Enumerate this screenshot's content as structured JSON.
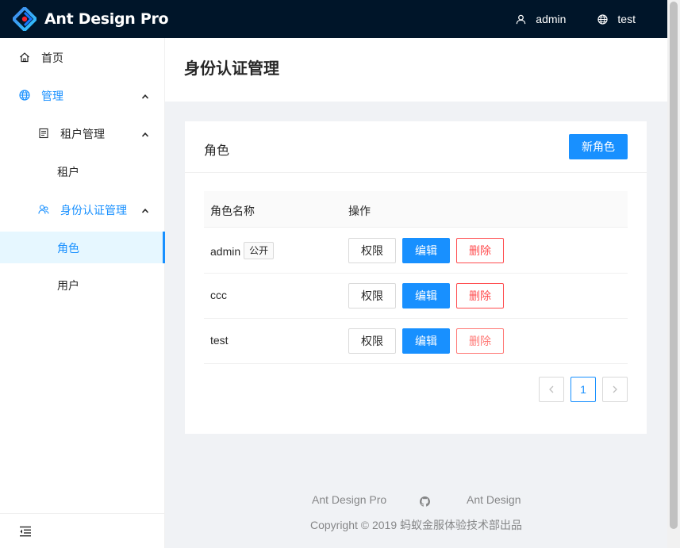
{
  "app": {
    "title": "Ant Design Pro"
  },
  "header": {
    "user": "admin",
    "tenant": "test"
  },
  "sidebar": {
    "items": [
      {
        "label": "首页"
      },
      {
        "label": "管理"
      },
      {
        "label": "租户管理"
      },
      {
        "label": "租户"
      },
      {
        "label": "身份认证管理"
      },
      {
        "label": "角色"
      },
      {
        "label": "用户"
      }
    ]
  },
  "page": {
    "title": "身份认证管理"
  },
  "card": {
    "title": "角色",
    "new_button": "新角色"
  },
  "table": {
    "columns": [
      "角色名称",
      "操作"
    ],
    "rows": [
      {
        "name": "admin",
        "tag": "公开",
        "actions": [
          "权限",
          "编辑",
          "删除"
        ]
      },
      {
        "name": "ccc",
        "tag": "",
        "actions": [
          "权限",
          "编辑",
          "删除"
        ]
      },
      {
        "name": "test",
        "tag": "",
        "actions": [
          "权限",
          "编辑",
          "删除"
        ]
      }
    ]
  },
  "pagination": {
    "current": "1"
  },
  "footer": {
    "links": [
      "Ant Design Pro",
      "Ant Design"
    ],
    "copyright": "Copyright © 2019 蚂蚁金服体验技术部出品"
  },
  "colors": {
    "header_bg": "#001529",
    "primary": "#1890ff",
    "danger": "#ff4d4f",
    "page_bg": "#f0f2f5"
  }
}
